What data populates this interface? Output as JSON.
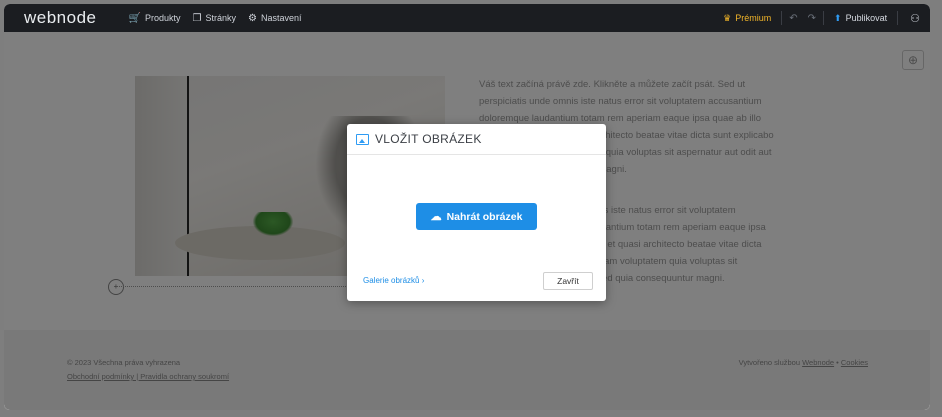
{
  "app": {
    "logo": "webnode"
  },
  "topbar": {
    "nav": [
      {
        "label": "Produkty",
        "icon": "cart-icon"
      },
      {
        "label": "Stránky",
        "icon": "pages-icon"
      },
      {
        "label": "Nastavení",
        "icon": "gear-icon"
      }
    ],
    "premium_label": "Prémium",
    "publish_label": "Publikovat"
  },
  "page": {
    "paragraph_1": "Váš text začíná právě zde. Klikněte a můžete začít psát. Sed ut perspiciatis unde omnis iste natus error sit voluptatem accusantium doloremque laudantium totam rem aperiam eaque ipsa quae ab illo inventore veritatis et quasi architecto beatae vitae dicta sunt explicabo nemo enim ipsam voluptatem quia voluptas sit aspernatur aut odit aut fugit sed quia consequuntur magni.",
    "paragraph_2": "Sed ut perspiciatis unde omnis iste natus error sit voluptatem accusantium doloremque laudantium totam rem aperiam eaque ipsa quae ab illo inventore veritatis et quasi architecto beatae vitae dicta sunt explicabo nemo enim ipsam voluptatem quia voluptas sit aspernatur aut odit aut fugit sed quia consequuntur magni."
  },
  "footer": {
    "copyright": "© 2023 Všechna práva vyhrazena",
    "links": "Obchodní podmínky | Pravidla ochrany soukromí",
    "made_with_prefix": "Vytvořeno službou ",
    "made_with_link": "Webnode",
    "separator": " • ",
    "cookies": "Cookies"
  },
  "modal": {
    "title": "VLOŽIT OBRÁZEK",
    "upload_label": "Nahrát obrázek",
    "gallery_label": "Galerie obrázků",
    "gallery_chevron": "›",
    "close_label": "Zavřít"
  },
  "colors": {
    "accent": "#1e8ee6",
    "premium": "#f0b429",
    "topbar": "#1b1d21"
  }
}
